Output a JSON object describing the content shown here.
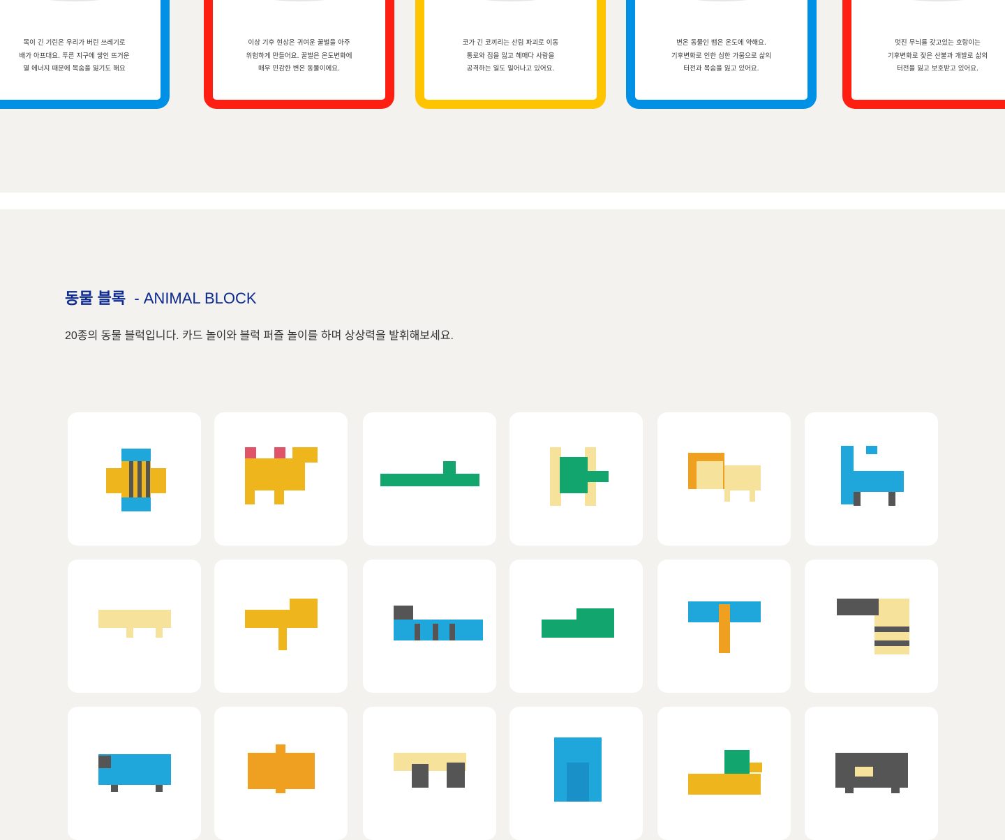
{
  "top_cards": [
    {
      "border_color": "#0090e6",
      "text": "목이 긴 기린은 우리가 버린 쓰레기로\n배가 아프대요. 푸른 지구에 쌓인 뜨거운\n열 에너지 때문에 목숨을 잃기도 해요"
    },
    {
      "border_color": "#ff1e12",
      "text": "이상 기후 현상은 귀여운 꿀벌을 아주\n위험하게 만들어요. 꿀벌은 온도변화에\n매우 민감한 변온 동물이에요."
    },
    {
      "border_color": "#ffc400",
      "text": "코가 긴 코끼리는 산림 파괴로 이동\n통로와 집을 잃고 헤매다 사람을\n공격하는 일도 일어나고 있어요."
    },
    {
      "border_color": "#0090e6",
      "text": "변온 동물인 뱀은 온도에 약해요.\n기후변화로 인한 심한 가뭄으로 삶의\n터전과 목숨을 잃고 있어요."
    },
    {
      "border_color": "#ff1e12",
      "text": "멋진 무늬를 갖고있는 호랑이는\n기후변화로 잦은 산불과 개발로 삶의\n터전을 잃고 보호받고 있어요."
    }
  ],
  "section": {
    "title_ko": "동물 블록",
    "title_en": "- ANIMAL BLOCK",
    "description": "20종의 동물 블럭입니다. 카드 놀이와 블럭 퍼즐 놀이를 하며 상상력을 발휘해보세요.",
    "title_color": "#0c2a8f"
  },
  "animals": [
    "bee-icon",
    "camel-icon",
    "crocodile-icon",
    "turtle-icon",
    "lion-icon",
    "giraffe-icon",
    "polar-bear-icon",
    "tiger-icon",
    "snake-icon",
    "crocodile-green-icon",
    "dragonfly-icon",
    "anteater-icon",
    "rhino-icon",
    "butterfly-icon",
    "panda-icon",
    "gorilla-icon",
    "duck-icon",
    "bear-icon"
  ]
}
